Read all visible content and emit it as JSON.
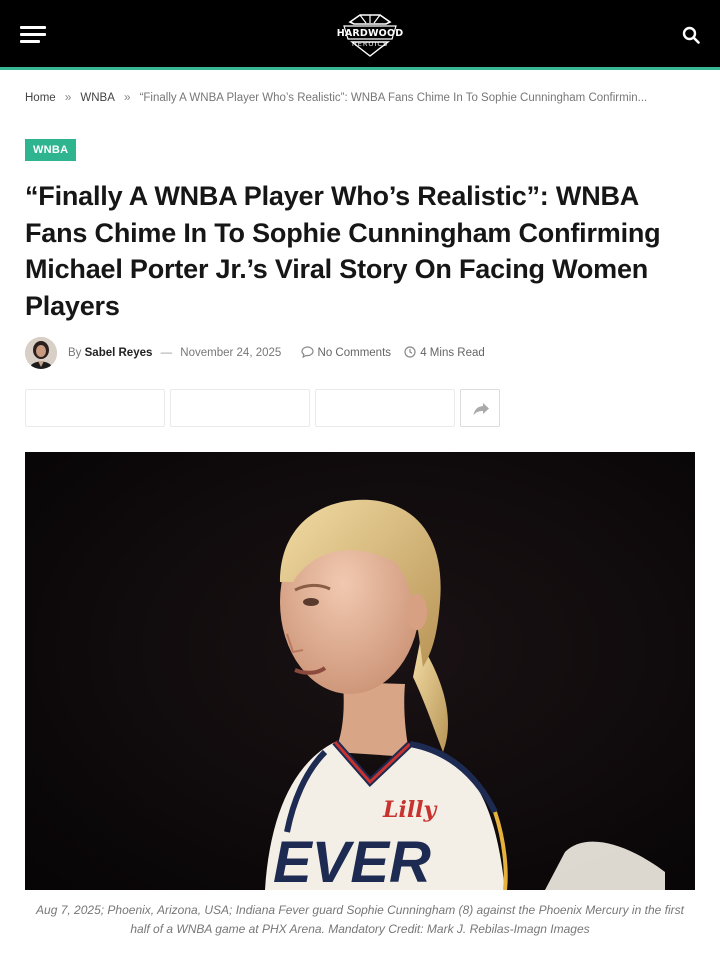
{
  "header": {
    "logo_line1": "HARDWOOD",
    "logo_line2": "HEROICS",
    "menu_icon": "hamburger-menu-icon",
    "search_icon": "search-icon",
    "accent_color": "#37b795"
  },
  "breadcrumb": {
    "home": "Home",
    "separator": "»",
    "category": "WNBA",
    "current": "“Finally A WNBA Player Who’s Realistic”: WNBA Fans Chime In To Sophie Cunningham Confirmin..."
  },
  "article": {
    "category_badge": "WNBA",
    "badge_color": "#2eb590",
    "title": "“Finally A WNBA Player Who’s Realistic”: WNBA Fans Chime In To Sophie Cunningham Confirming Michael Porter Jr.’s Viral Story On Facing Women Players",
    "meta": {
      "by": "By",
      "author": "Sabel Reyes",
      "dash": "—",
      "date": "November 24, 2025",
      "comments": "No Comments",
      "read_time": "4 Mins Read"
    },
    "share": {
      "more_icon": "share-arrow-icon"
    },
    "hero_image": {
      "jersey_text": "EVER",
      "sponsor_text": "Lilly",
      "caption": "Aug 7, 2025; Phoenix, Arizona, USA; Indiana Fever guard Sophie Cunningham (8) against the Phoenix Mercury in the first half of a WNBA game at PHX Arena. Mandatory Credit: Mark J. Rebilas-Imagn Images"
    }
  }
}
